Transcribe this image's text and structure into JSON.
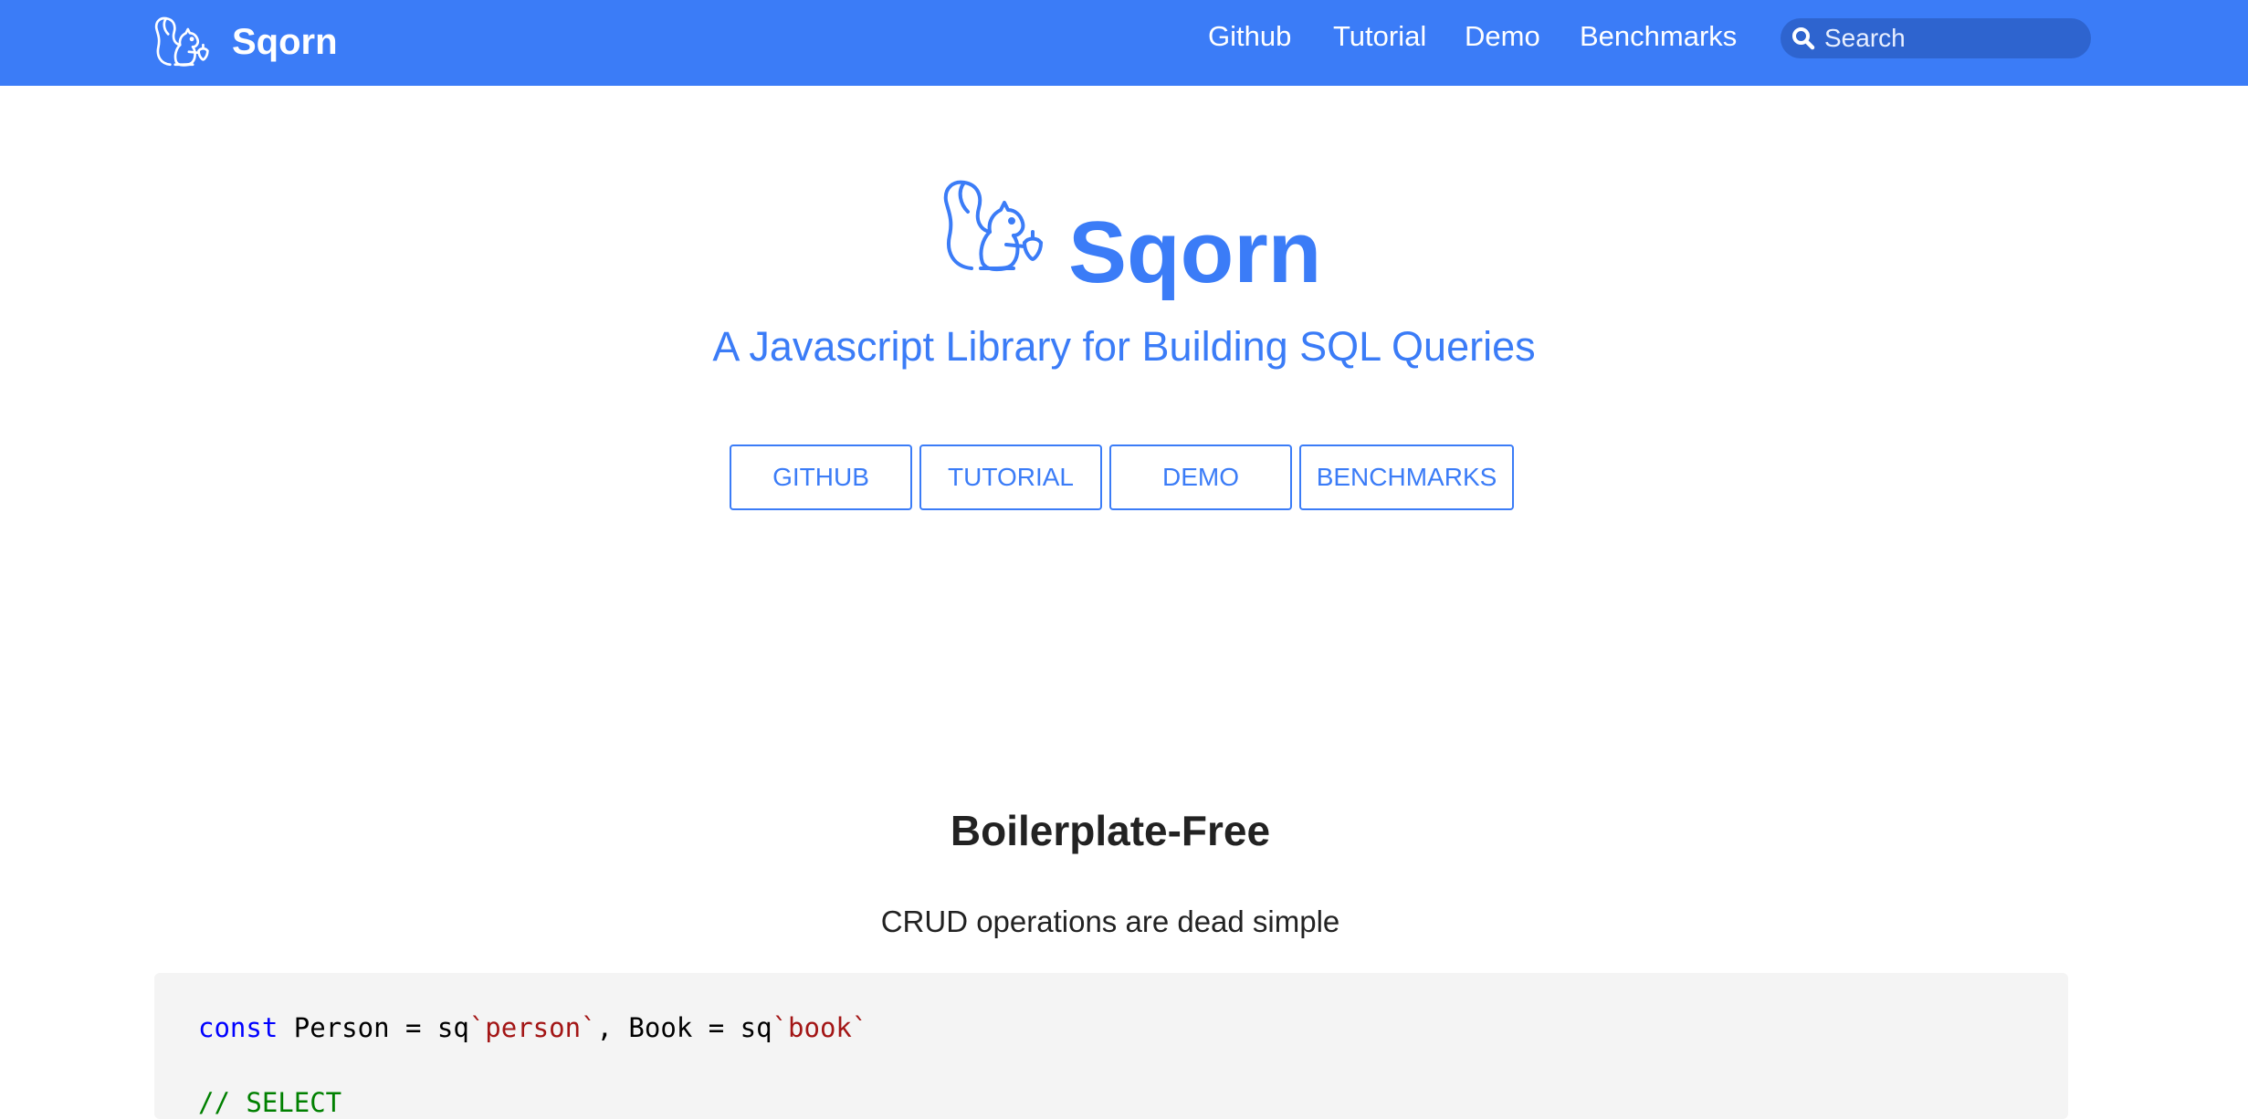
{
  "navbar": {
    "brand": "Sqorn",
    "links": [
      "Github",
      "Tutorial",
      "Demo",
      "Benchmarks"
    ],
    "search_placeholder": "Search"
  },
  "hero": {
    "title": "Sqorn",
    "tagline": "A Javascript Library for Building SQL Queries",
    "buttons": [
      "GITHUB",
      "TUTORIAL",
      "DEMO",
      "BENCHMARKS"
    ]
  },
  "section": {
    "title": "Boilerplate-Free",
    "subtitle": "CRUD operations are dead simple"
  },
  "code": {
    "line1": {
      "kw": "const",
      "p1": " Person = sq",
      "s1": "`person`",
      "p2": ", Book = sq",
      "s2": "`book`"
    },
    "line2_comment": "// SELECT"
  },
  "colors": {
    "accent": "#3b7cf7",
    "search_bg": "#2e64cf",
    "code_bg": "#f4f4f4",
    "keyword": "#0000ff",
    "string": "#a31515",
    "comment": "#008000"
  },
  "icons": {
    "brand": "squirrel-logo-icon",
    "search": "search-icon"
  }
}
